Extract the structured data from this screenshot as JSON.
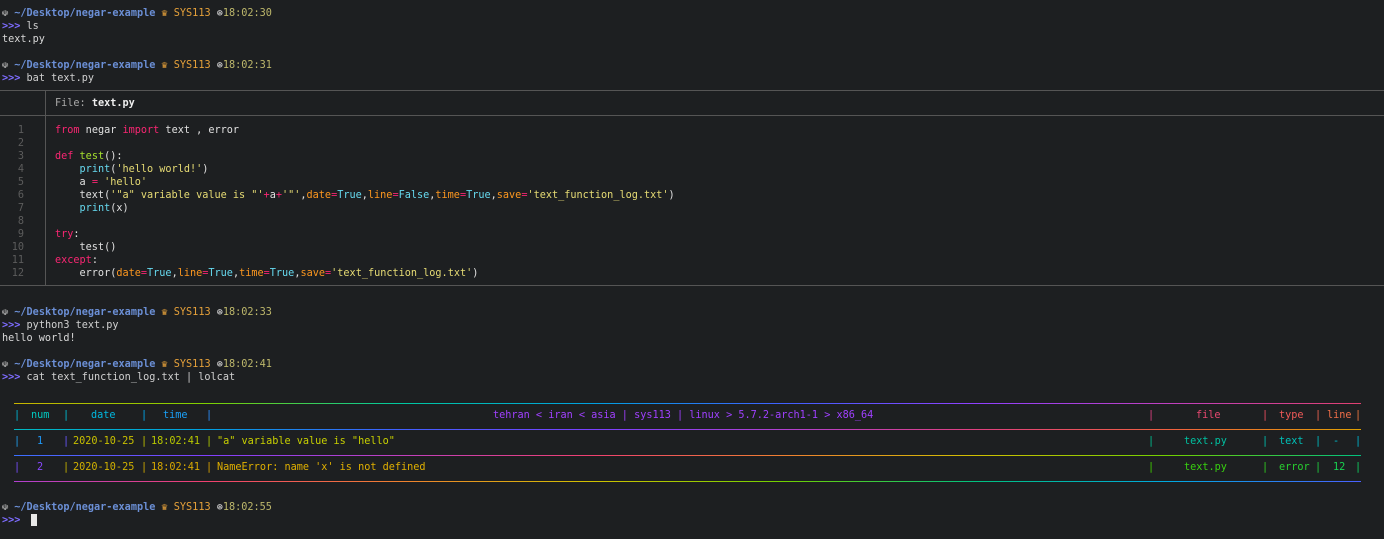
{
  "prompts": [
    {
      "path": "~/Desktop/negar-example",
      "host": "SYS113",
      "time": "18:02:30",
      "command": "ls",
      "output": "text.py"
    },
    {
      "path": "~/Desktop/negar-example",
      "host": "SYS113",
      "time": "18:02:31",
      "command": "bat text.py"
    },
    {
      "path": "~/Desktop/negar-example",
      "host": "SYS113",
      "time": "18:02:33",
      "command": "python3 text.py",
      "output": "hello world!"
    },
    {
      "path": "~/Desktop/negar-example",
      "host": "SYS113",
      "time": "18:02:41",
      "command": "cat text_function_log.txt | lolcat"
    },
    {
      "path": "~/Desktop/negar-example",
      "host": "SYS113",
      "time": "18:02:55",
      "command": ""
    }
  ],
  "prompt_arrows": ">>>",
  "bat": {
    "file_label": "File:",
    "file_name": "text.py",
    "line_numbers": [
      "1",
      "2",
      "3",
      "4",
      "5",
      "6",
      "7",
      "8",
      "9",
      "10",
      "11",
      "12"
    ]
  },
  "log_table": {
    "headers": {
      "num": "num",
      "date": "date",
      "time": "time",
      "message": "tehran < iran < asia | sys113 | linux > 5.7.2-arch1-1 > x86_64",
      "file": "file",
      "type": "type",
      "line": "line"
    },
    "rows": [
      {
        "num": "1",
        "date": "2020-10-25",
        "time": "18:02:41",
        "message": "\"a\" variable value is \"hello\"",
        "file": "text.py",
        "type": "text",
        "line": "-"
      },
      {
        "num": "2",
        "date": "2020-10-25",
        "time": "18:02:41",
        "message": "NameError: name 'x' is not defined",
        "file": "text.py",
        "type": "error",
        "line": "12"
      }
    ]
  }
}
